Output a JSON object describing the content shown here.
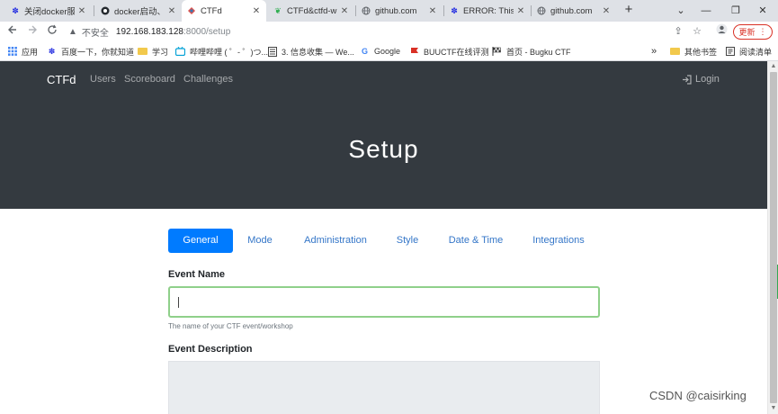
{
  "browser": {
    "tabs": [
      {
        "title": "关闭docker服务",
        "icon": "paw"
      },
      {
        "title": "docker启动、",
        "icon": "docker"
      },
      {
        "title": "CTFd",
        "icon": "ctfd",
        "active": true
      },
      {
        "title": "CTFd&ctfd-w",
        "icon": "leaf"
      },
      {
        "title": "github.com",
        "icon": "globe"
      },
      {
        "title": "ERROR: This i",
        "icon": "paw"
      },
      {
        "title": "github.com",
        "icon": "globe"
      }
    ],
    "new_tab": "+",
    "window_controls": {
      "minimize": "—",
      "restore": "❐",
      "close": "✕",
      "tab_search": "⌄"
    },
    "address": {
      "security_label": "不安全",
      "host": "192.168.183.128",
      "path": ":8000/setup"
    },
    "update_label": "更新",
    "bookmarks": [
      {
        "label": "应用",
        "icon": "apps"
      },
      {
        "label": "百度一下，你就知道",
        "icon": "paw"
      },
      {
        "label": "学习",
        "icon": "folder"
      },
      {
        "label": "哔哩哔哩 ( ゜- ゜)つ...",
        "icon": "tv"
      },
      {
        "label": "3. 信息收集 — We...",
        "icon": "doc"
      },
      {
        "label": "Google",
        "icon": "google"
      },
      {
        "label": "BUUCTF在线评测",
        "icon": "flag-red"
      },
      {
        "label": "首页 - Bugku CTF",
        "icon": "flag"
      }
    ],
    "bookmarks_more": "»",
    "other_bookmarks": "其他书签",
    "reading_list": "阅读清单"
  },
  "nav": {
    "brand": "CTFd",
    "links": [
      "Users",
      "Scoreboard",
      "Challenges"
    ],
    "login": "Login"
  },
  "hero": {
    "title": "Setup"
  },
  "setup_tabs": [
    {
      "label": "General",
      "active": true
    },
    {
      "label": "Mode"
    },
    {
      "label": "Administration"
    },
    {
      "label": "Style"
    },
    {
      "label": "Date & Time"
    },
    {
      "label": "Integrations"
    }
  ],
  "form": {
    "event_name_label": "Event Name",
    "event_name_value": "",
    "event_name_help": "The name of your CTF event/workshop",
    "event_description_label": "Event Description"
  },
  "watermark": "CSDN @caisirking",
  "colors": {
    "navbar": "#343a40",
    "active_tab": "#007bff",
    "tab_link": "#3476c8",
    "input_focus_border": "#8fd08a"
  }
}
